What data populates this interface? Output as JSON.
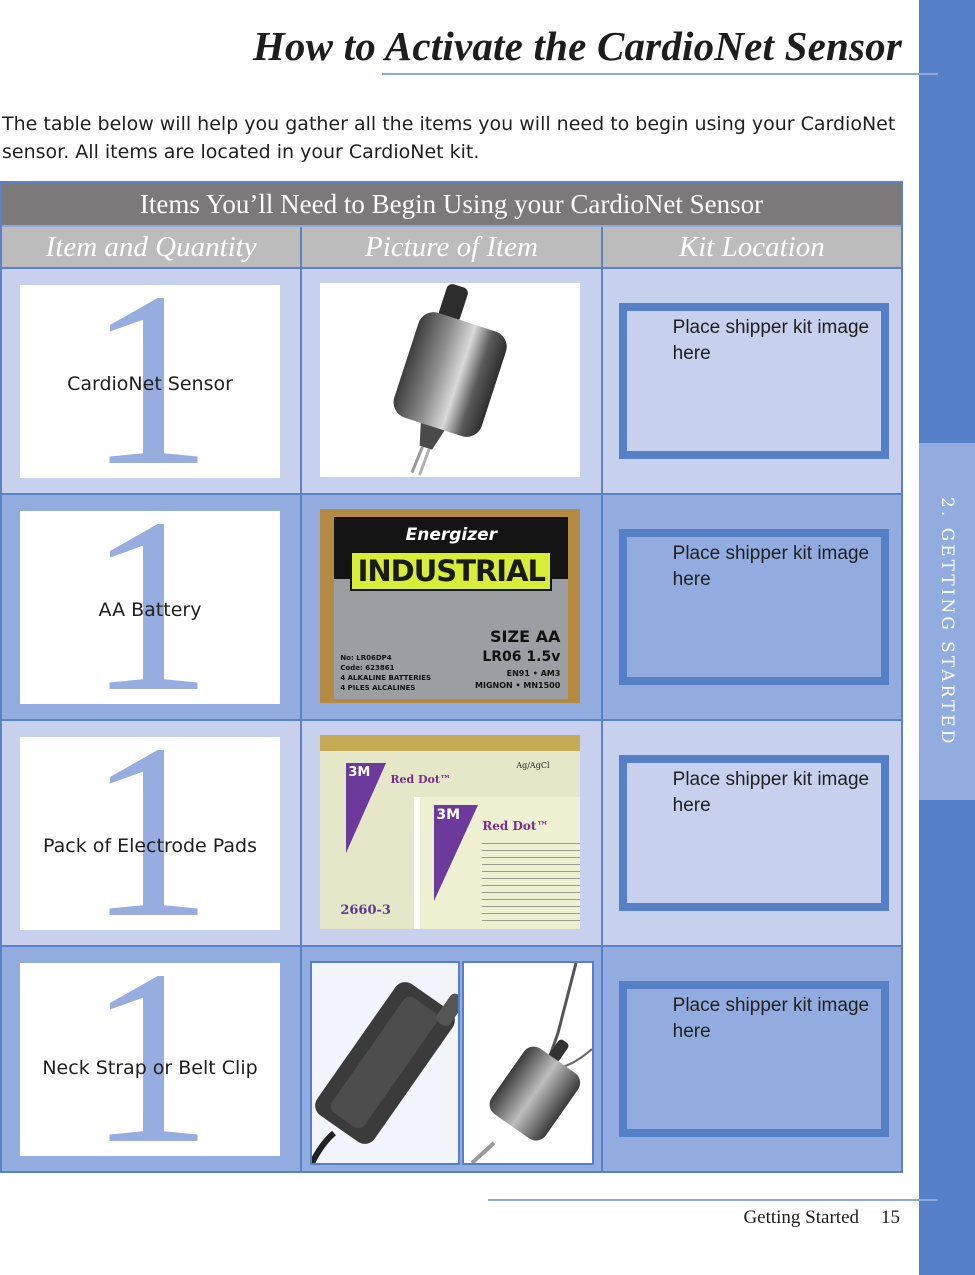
{
  "page": {
    "title": "How to Activate the CardioNet Sensor",
    "intro": "The table below will help you gather all the items you will need to begin using your CardioNet sensor. All items are located in your CardioNet kit.",
    "side_tab": "2. GETTING STARTED",
    "footer": {
      "section": "Getting Started",
      "page_number": "15"
    }
  },
  "colors": {
    "accent_blue": "#5580c8",
    "light_row": "#c7d1ee",
    "dark_row": "#93ace0",
    "caption_gray": "#7b7979",
    "header_gray": "#bcbcbc"
  },
  "table": {
    "caption": "Items You’ll Need to Begin Using your CardioNet Sensor",
    "columns": [
      "Item and Quantity",
      "Picture of Item",
      "Kit Location"
    ],
    "rows": [
      {
        "quantity": "1",
        "item": "CardioNet Sensor",
        "picture": "cardionet-sensor-photo",
        "kit_location": "Place shipper kit image here"
      },
      {
        "quantity": "1",
        "item": "AA Battery",
        "picture": "energizer-industrial-aa-battery-box-photo",
        "kit_location": "Place shipper kit image here"
      },
      {
        "quantity": "1",
        "item": "Pack of Electrode Pads",
        "picture": "3m-red-dot-electrode-pads-photo",
        "kit_location": "Place shipper kit image here"
      },
      {
        "quantity": "1",
        "item": "Neck Strap or Belt Clip",
        "picture": "belt-clip-and-neck-strap-photos",
        "kit_location": "Place shipper kit image here"
      }
    ]
  },
  "battery_box": {
    "brand": "Energizer",
    "product": "INDUSTRIAL",
    "size": "SIZE AA",
    "model": "LR06 1.5v",
    "codes": "EN91 • AM3",
    "alt": "MIGNON • MN1500",
    "left_lines": [
      "No: LR06DP4",
      "Code: 623861",
      "4 ALKALINE BATTERIES",
      "4 PILES ALCALINES"
    ]
  },
  "electrode_pack": {
    "brand": "3M",
    "product": "Red Dot™",
    "code": "2660-3",
    "marking": "Ag/AgCl"
  }
}
